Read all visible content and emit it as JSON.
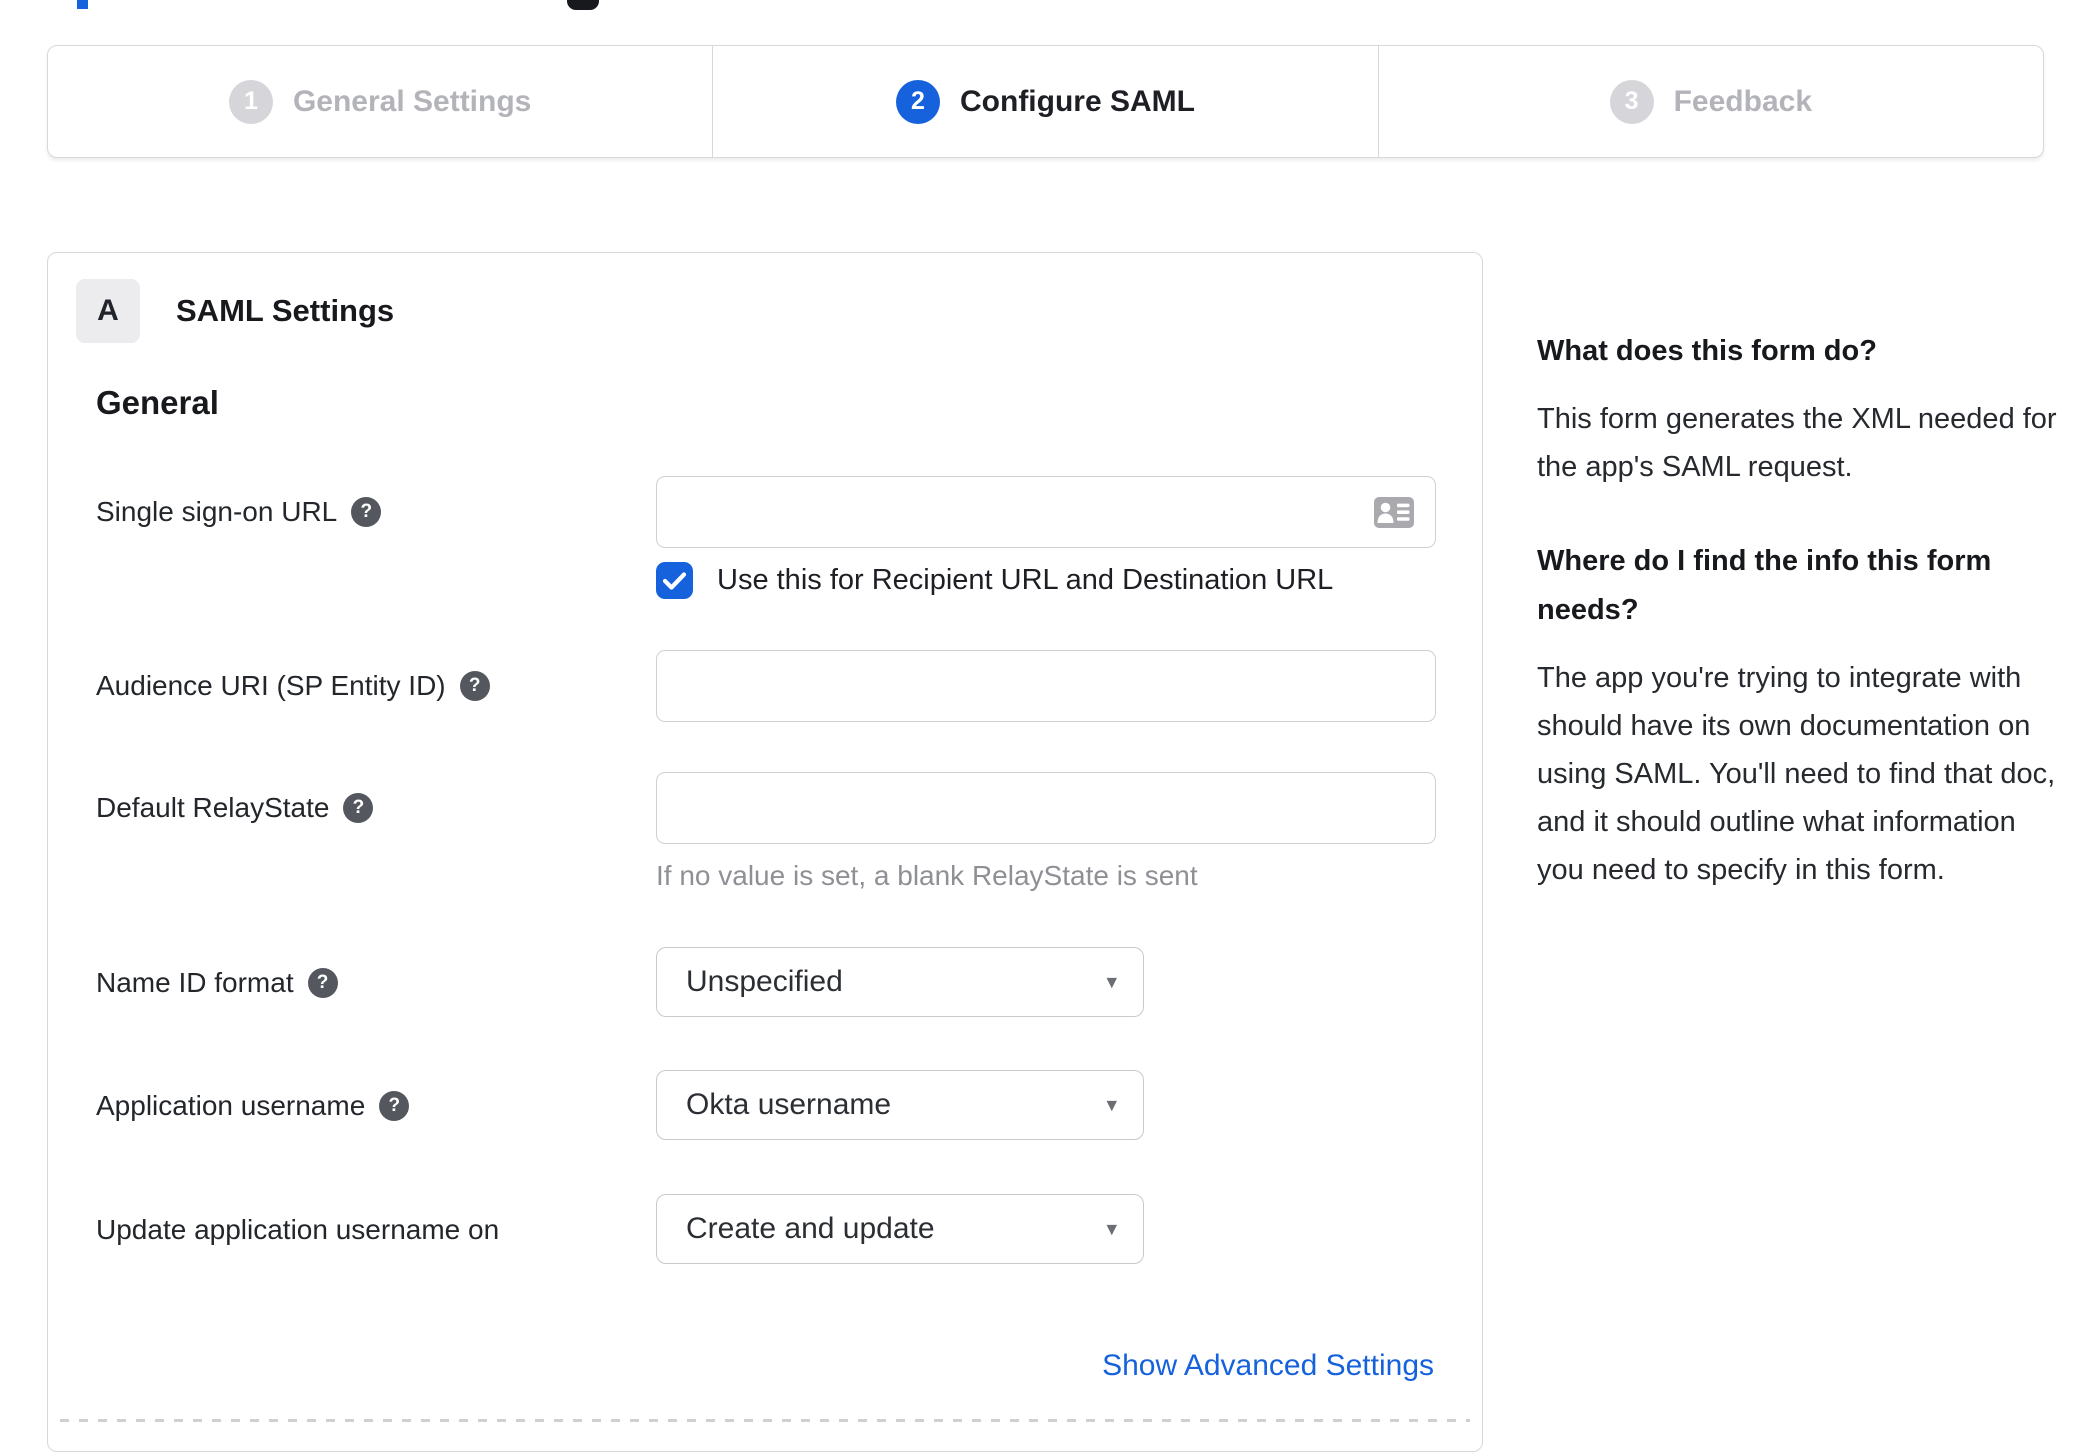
{
  "colors": {
    "accent": "#1662dd",
    "link": "#1662dd",
    "inactive_step": "#d6d6da"
  },
  "icons": {
    "help": "?",
    "caret": "▾",
    "contact_card": "contact-card",
    "checkmark": "check"
  },
  "stepper": {
    "steps": [
      {
        "number": "1",
        "label": "General Settings",
        "state": "inactive"
      },
      {
        "number": "2",
        "label": "Configure SAML",
        "state": "active"
      },
      {
        "number": "3",
        "label": "Feedback",
        "state": "inactive"
      }
    ]
  },
  "panel": {
    "badge": "A",
    "title": "SAML Settings",
    "section": "General",
    "fields": {
      "sso": {
        "label": "Single sign-on URL",
        "value": "",
        "checkbox_label": "Use this for Recipient URL and Destination URL",
        "checkbox_checked": true
      },
      "audience": {
        "label": "Audience URI (SP Entity ID)",
        "value": ""
      },
      "relay": {
        "label": "Default RelayState",
        "value": "",
        "hint": "If no value is set, a blank RelayState is sent"
      },
      "name_id": {
        "label": "Name ID format",
        "value": "Unspecified"
      },
      "app_username": {
        "label": "Application username",
        "value": "Okta username"
      },
      "update_username": {
        "label": "Update application username on",
        "value": "Create and update"
      }
    },
    "advanced_link": "Show Advanced Settings"
  },
  "sidebar": {
    "q1": "What does this form do?",
    "a1": "This form generates the XML needed for the app's SAML request.",
    "q2": "Where do I find the info this form needs?",
    "a2": "The app you're trying to integrate with should have its own documentation on using SAML. You'll need to find that doc, and it should outline what information you need to specify in this form."
  }
}
